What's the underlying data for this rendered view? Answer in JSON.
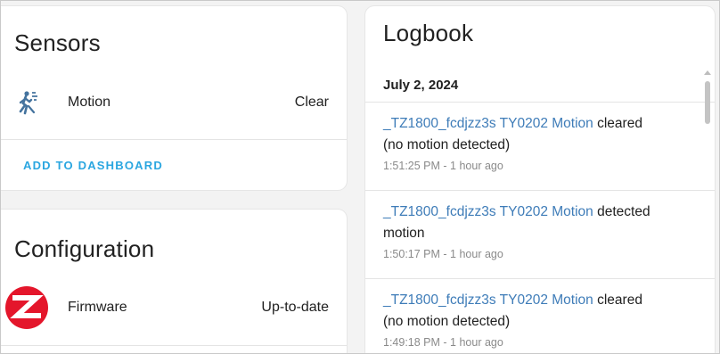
{
  "sensors": {
    "title": "Sensors",
    "rows": [
      {
        "icon": "motion-sensor-icon",
        "label": "Motion",
        "value": "Clear"
      }
    ],
    "add_to_dashboard": "ADD TO DASHBOARD"
  },
  "configuration": {
    "title": "Configuration",
    "rows": [
      {
        "icon": "zigbee-logo-icon",
        "label": "Firmware",
        "value": "Up-to-date"
      }
    ]
  },
  "logbook": {
    "title": "Logbook",
    "date": "July 2, 2024",
    "entries": [
      {
        "entity": "_TZ1800_fcdjzz3s TY0202 Motion",
        "message_1": "cleared",
        "message_2": "(no motion detected)",
        "time": "1:51:25 PM - 1 hour ago"
      },
      {
        "entity": "_TZ1800_fcdjzz3s TY0202 Motion",
        "message_1": "detected",
        "message_2": "motion",
        "time": "1:50:17 PM - 1 hour ago"
      },
      {
        "entity": "_TZ1800_fcdjzz3s TY0202 Motion",
        "message_1": "cleared",
        "message_2": "(no motion detected)",
        "time": "1:49:18 PM - 1 hour ago"
      }
    ]
  },
  "colors": {
    "accent": "#2aa6e0",
    "entity_link": "#3e7cb8",
    "zigbee_red": "#e4162b"
  }
}
